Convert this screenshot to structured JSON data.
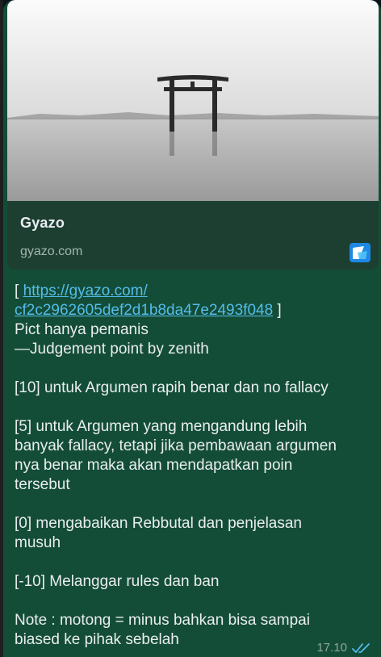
{
  "link_preview": {
    "title": "Gyazo",
    "domain": "gyazo.com",
    "image_icon": "torii-gate-photo",
    "logo_icon": "gyazo-logo-icon"
  },
  "message": {
    "link_open_bracket": "[ ",
    "link_line1": "https://gyazo.com/",
    "link_line2": "cf2c2962605def2d1b8da47e2493f048",
    "link_close_bracket": " ]",
    "lines": [
      "Pict hanya pemanis",
      "—Judgement point by zenith",
      "",
      "[10] untuk Argumen rapih benar dan no fallacy",
      "",
      "[5] untuk Argumen yang mengandung lebih",
      "banyak fallacy, tetapi jika pembawaan argumen",
      "nya benar maka akan mendapatkan poin",
      "tersebut",
      "",
      "[0] mengabaikan Rebbutal dan penjelasan",
      "musuh",
      "",
      "[-10] Melanggar rules dan ban",
      "",
      "Note : motong = minus bahkan bisa sampai",
      "biased ke pihak sebelah"
    ]
  },
  "meta": {
    "time": "17.10",
    "status_icon": "double-check-icon"
  },
  "colors": {
    "bubble_bg": "#144d37",
    "preview_bg": "#1d3f32",
    "link": "#53bdeb",
    "text": "#e9edef",
    "read_ticks": "#53bdeb"
  }
}
